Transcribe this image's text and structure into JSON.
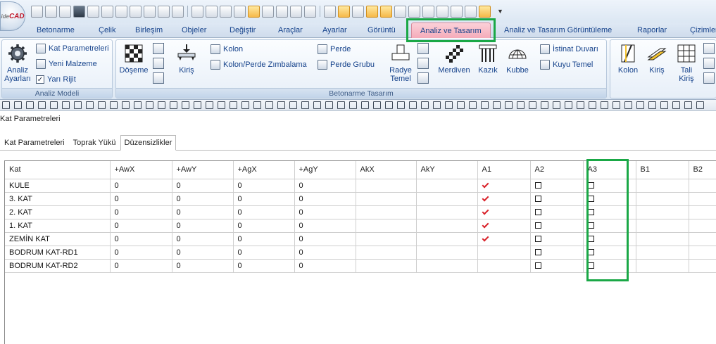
{
  "app": {
    "logo_prefix": "ide",
    "logo_text": "CAD"
  },
  "ribbon_tabs": [
    {
      "label": "Betonarme",
      "active": false
    },
    {
      "label": "Çelik",
      "active": false
    },
    {
      "label": "Birleşim",
      "active": false
    },
    {
      "label": "Objeler",
      "active": false
    },
    {
      "label": "Değiştir",
      "active": false
    },
    {
      "label": "Araçlar",
      "active": false
    },
    {
      "label": "Ayarlar",
      "active": false
    },
    {
      "label": "Görüntü",
      "active": false
    },
    {
      "label": "Analiz ve Tasarım",
      "active": true
    },
    {
      "label": "Analiz ve Tasarım Görüntüleme",
      "active": false
    },
    {
      "label": "Raporlar",
      "active": false
    },
    {
      "label": "Çizimler",
      "active": false
    }
  ],
  "ribbon": {
    "analiz_modeli": {
      "group_label": "Analiz Modeli",
      "analiz_ayarlari_line1": "Analiz",
      "analiz_ayarlari_line2": "Ayarları",
      "kat_parametreleri": "Kat Parametreleri",
      "yeni_malzeme": "Yeni Malzeme",
      "yari_rijit": "Yarı Rijit",
      "yari_rijit_checked": true
    },
    "betonarme_tasarim": {
      "group_label": "Betonarme Tasarım",
      "doseme": "Döşeme",
      "kiris": "Kiriş",
      "kolon": "Kolon",
      "kolon_perde_zimbalama": "Kolon/Perde Zımbalama",
      "perde": "Perde",
      "perde_grubu": "Perde Grubu",
      "radye_temel_line1": "Radye",
      "radye_temel_line2": "Temel",
      "merdiven": "Merdiven",
      "kazik": "Kazık",
      "kubbe": "Kubbe",
      "istinat_duvari": "İstinat Duvarı",
      "kuyu_temel": "Kuyu Temel"
    },
    "celik_tasarim": {
      "kolon": "Kolon",
      "kiris": "Kiriş",
      "tali_kiris_line1": "Tali",
      "tali_kiris_line2": "Kiriş"
    }
  },
  "panel": {
    "title": "Kat Parametreleri",
    "tabs": [
      {
        "label": "Kat Parametreleri",
        "active": false
      },
      {
        "label": "Toprak Yükü",
        "active": false
      },
      {
        "label": "Düzensizlikler",
        "active": true
      }
    ]
  },
  "table": {
    "columns": [
      "Kat",
      "+AwX",
      "+AwY",
      "+AgX",
      "+AgY",
      "AkX",
      "AkY",
      "A1",
      "A2",
      "A3",
      "B1",
      "B2"
    ],
    "rows": [
      {
        "kat": "KULE",
        "awx": "0",
        "awy": "0",
        "agx": "0",
        "agy": "0",
        "akx": "",
        "aky": "",
        "a1": true,
        "a2": false,
        "a3": false
      },
      {
        "kat": "3. KAT",
        "awx": "0",
        "awy": "0",
        "agx": "0",
        "agy": "0",
        "akx": "",
        "aky": "",
        "a1": true,
        "a2": false,
        "a3": false
      },
      {
        "kat": "2. KAT",
        "awx": "0",
        "awy": "0",
        "agx": "0",
        "agy": "0",
        "akx": "",
        "aky": "",
        "a1": true,
        "a2": false,
        "a3": false
      },
      {
        "kat": "1. KAT",
        "awx": "0",
        "awy": "0",
        "agx": "0",
        "agy": "0",
        "akx": "",
        "aky": "",
        "a1": true,
        "a2": false,
        "a3": false
      },
      {
        "kat": "ZEMİN KAT",
        "awx": "0",
        "awy": "0",
        "agx": "0",
        "agy": "0",
        "akx": "",
        "aky": "",
        "a1": true,
        "a2": false,
        "a3": false
      },
      {
        "kat": "BODRUM KAT-RD1",
        "awx": "0",
        "awy": "0",
        "agx": "0",
        "agy": "0",
        "akx": "",
        "aky": "",
        "a1": false,
        "a2": false,
        "a3": false
      },
      {
        "kat": "BODRUM KAT-RD2",
        "awx": "0",
        "awy": "0",
        "agx": "0",
        "agy": "0",
        "akx": "",
        "aky": "",
        "a1": false,
        "a2": false,
        "a3": false
      }
    ]
  },
  "colors": {
    "highlight": "#1aa846",
    "active_tab": "#f5a9b8",
    "tab_text": "#15428b",
    "checkmark": "#d9222a"
  }
}
